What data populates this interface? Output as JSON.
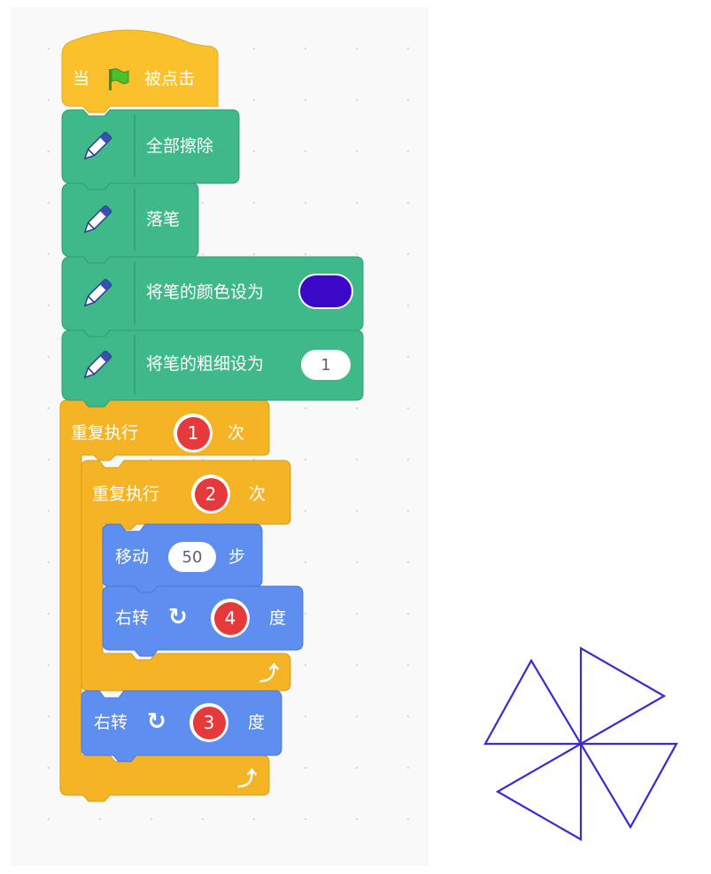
{
  "blocks": {
    "when_flag": {
      "prefix": "当",
      "suffix": "被点击"
    },
    "erase_all": {
      "label": "全部擦除"
    },
    "pen_down": {
      "label": "落笔"
    },
    "set_pen_color": {
      "label": "将笔的颜色设为",
      "color": "#3a08c6"
    },
    "set_pen_size": {
      "label": "将笔的粗细设为",
      "value": "1"
    },
    "repeat_outer": {
      "prefix": "重复执行",
      "badge": "1",
      "suffix": "次"
    },
    "repeat_inner": {
      "prefix": "重复执行",
      "badge": "2",
      "suffix": "次"
    },
    "move": {
      "prefix": "移动",
      "value": "50",
      "suffix": "步"
    },
    "turn_inner": {
      "prefix": "右转",
      "badge": "4",
      "suffix": "度"
    },
    "turn_outer": {
      "prefix": "右转",
      "badge": "3",
      "suffix": "度"
    }
  },
  "colors": {
    "events": "#fbc12d",
    "pen": "#3fb98a",
    "control": "#f5b426",
    "motion": "#5e8ef0",
    "badge": "#e5393b",
    "drawing": "#3a2ad0"
  },
  "icons": [
    "green-flag-icon",
    "pen-icon",
    "turn-right-icon",
    "loop-arrow-icon"
  ]
}
